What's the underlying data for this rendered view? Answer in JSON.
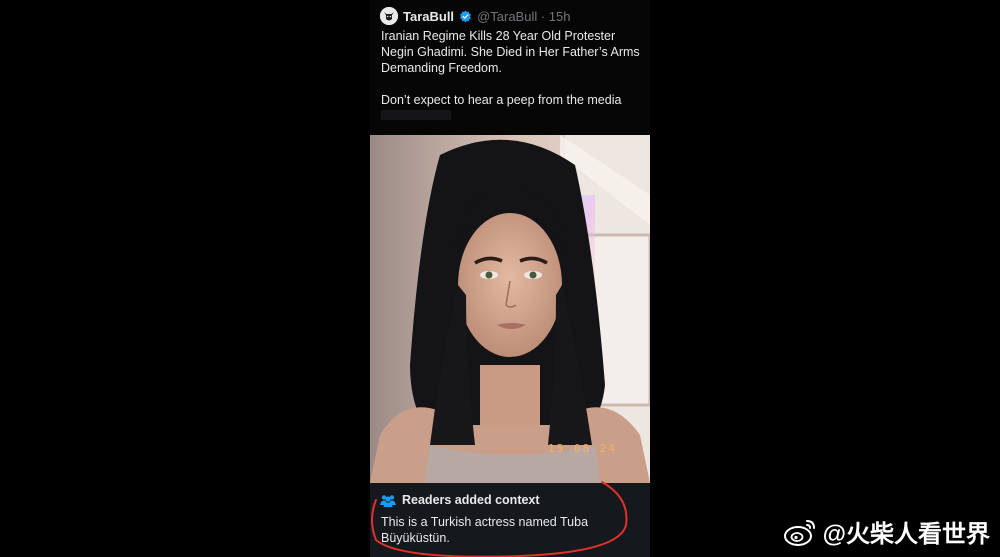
{
  "tweet": {
    "display_name": "TaraBull",
    "handle_time": "@TaraBull · 15h",
    "text_paragraph_1": "Iranian Regime Kills 28 Year Old Protester Negin Ghadimi. She Died in Her Father’s Arms Demanding Freedom.",
    "text_paragraph_2": "Don’t expect to hear a peep from the media",
    "photo_timestamp": "15 08 24"
  },
  "community_note": {
    "title": "Readers added context",
    "body": "This is a Turkish actress named Tuba Büyüküstün."
  },
  "watermark": {
    "text": "@火柴人看世界"
  },
  "colors": {
    "background": "#000000",
    "card": "#060607",
    "note_background": "#15181c",
    "note_icon": "#1d9bf0",
    "verified_badge": "#1d9bf0",
    "annotation_circle": "#e0312b"
  }
}
